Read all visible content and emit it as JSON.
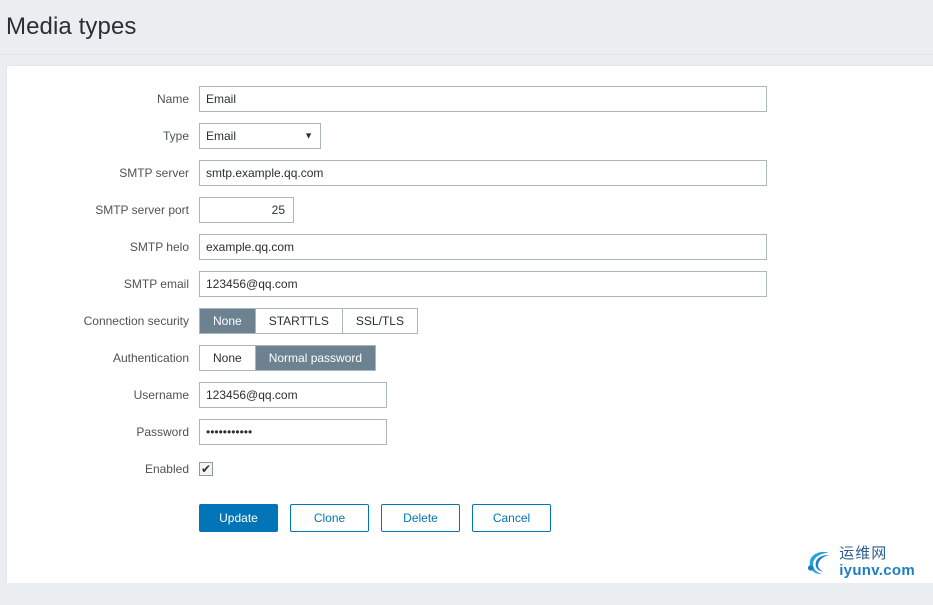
{
  "header": {
    "title": "Media types"
  },
  "form": {
    "rows": {
      "name": {
        "label": "Name",
        "value": "Email"
      },
      "type": {
        "label": "Type",
        "value": "Email",
        "options": [
          "Email"
        ],
        "arrow_icon": "▼"
      },
      "smtp_server": {
        "label": "SMTP server",
        "value": "smtp.example.qq.com"
      },
      "smtp_server_port": {
        "label": "SMTP server port",
        "value": "25"
      },
      "smtp_helo": {
        "label": "SMTP helo",
        "value": "example.qq.com"
      },
      "smtp_email": {
        "label": "SMTP email",
        "value": "123456@qq.com"
      },
      "connection_security": {
        "label": "Connection security",
        "options": [
          "None",
          "STARTTLS",
          "SSL/TLS"
        ],
        "selected": "None"
      },
      "authentication": {
        "label": "Authentication",
        "options": [
          "None",
          "Normal password"
        ],
        "selected": "Normal password"
      },
      "username": {
        "label": "Username",
        "value": "123456@qq.com"
      },
      "password": {
        "label": "Password",
        "value": "•••••••••••"
      },
      "enabled": {
        "label": "Enabled",
        "checked": true,
        "tick_icon": "✔"
      }
    }
  },
  "buttons": {
    "update": "Update",
    "clone": "Clone",
    "delete": "Delete",
    "cancel": "Cancel"
  },
  "watermark": {
    "cn_text": "运维网",
    "en_text": "iyunv.com"
  },
  "colors": {
    "accent": "#0275b8",
    "segment_selected": "#6c8291",
    "page_background": "#ebeef1",
    "input_border": "#aab7c0"
  }
}
